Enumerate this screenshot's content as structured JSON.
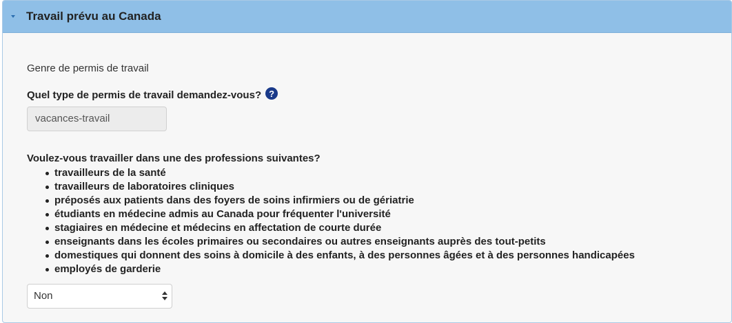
{
  "panel": {
    "title": "Travail prévu au Canada",
    "section_label": "Genre de permis de travail",
    "question_permit": "Quel type de permis de travail demandez-vous?",
    "help_symbol": "?",
    "permit_value": "vacances-travail",
    "question_professions": "Voulez-vous travailler dans une des professions suivantes?",
    "professions": [
      "travailleurs de la santé",
      "travailleurs de laboratoires cliniques",
      "préposés aux patients dans des foyers de soins infirmiers ou de gériatrie",
      "étudiants en médecine admis au Canada pour fréquenter l'université",
      "stagiaires en médecine et médecins en affectation de courte durée",
      "enseignants dans les écoles primaires ou secondaires ou autres enseignants auprès des tout-petits",
      "domestiques qui donnent des soins à domicile à des enfants, à des personnes âgées et à des personnes handicapées",
      "employés de garderie"
    ],
    "profession_answer": "Non"
  },
  "colors": {
    "header_bg": "#8fbfe7",
    "panel_bg": "#f7f7f7",
    "help_icon_bg": "#1a3a8a"
  },
  "icons": {
    "collapse": "caret-down-icon",
    "help": "question-circle-icon",
    "select": "up-down-arrows-icon"
  }
}
